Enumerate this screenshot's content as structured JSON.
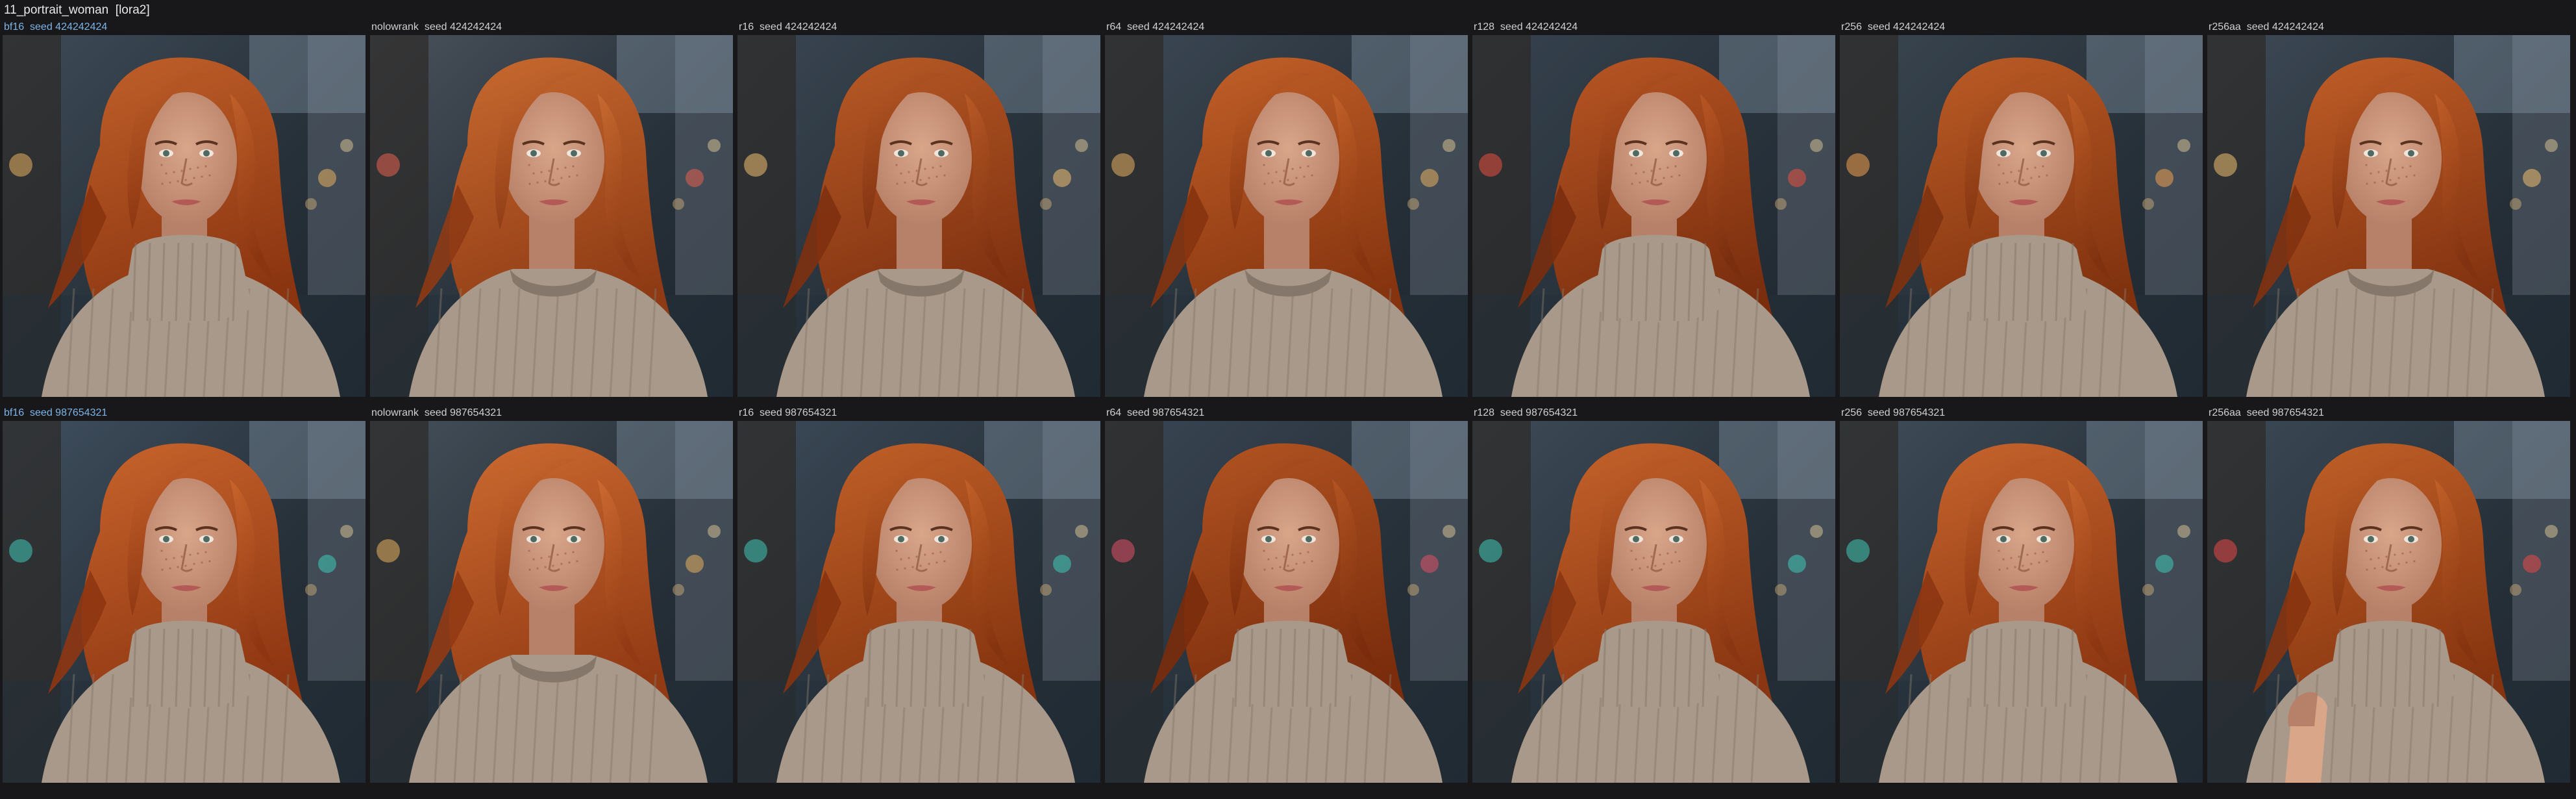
{
  "page": {
    "title": "11_portrait_woman  [lora2]"
  },
  "grid": {
    "rows": [
      {
        "cells": [
          {
            "label": "bf16  seed 424242424",
            "highlight": true,
            "variant": "turtleneck",
            "hair": "#8a3410",
            "hairHi": "#c0602a",
            "bg": "#3e4b57",
            "glow": "#e8b060"
          },
          {
            "label": "nolowrank  seed 424242424",
            "highlight": false,
            "variant": "crewneck",
            "hair": "#8e3a14",
            "hairHi": "#c86a30",
            "bg": "#4a525c",
            "glow": "#e66050"
          },
          {
            "label": "r16  seed 424242424",
            "highlight": false,
            "variant": "crewneck",
            "hair": "#7e3010",
            "hairHi": "#b85a26",
            "bg": "#3a4652",
            "glow": "#f0c070"
          },
          {
            "label": "r64  seed 424242424",
            "highlight": false,
            "variant": "crewneck",
            "hair": "#86340f",
            "hairHi": "#c26028",
            "bg": "#3c4854",
            "glow": "#e8b060"
          },
          {
            "label": "r128  seed 424242424",
            "highlight": false,
            "variant": "turtleneck",
            "hair": "#7a2e0e",
            "hairHi": "#b85624",
            "bg": "#36424e",
            "glow": "#e85040"
          },
          {
            "label": "r256  seed 424242424",
            "highlight": false,
            "variant": "turtleneck",
            "hair": "#80320f",
            "hairHi": "#bc5c26",
            "bg": "#3a4650",
            "glow": "#f0a050"
          },
          {
            "label": "r256aa  seed 424242424",
            "highlight": false,
            "variant": "crewneck",
            "hair": "#823210",
            "hairHi": "#c05e28",
            "bg": "#3e4a56",
            "glow": "#f0c070"
          }
        ]
      },
      {
        "cells": [
          {
            "label": "bf16  seed 987654321",
            "highlight": true,
            "variant": "turtleneck",
            "hair": "#8e3612",
            "hairHi": "#c8642c",
            "bg": "#405060",
            "glow": "#40c8b8"
          },
          {
            "label": "nolowrank  seed 987654321",
            "highlight": false,
            "variant": "crewneck",
            "hair": "#923a14",
            "hairHi": "#cc6a30",
            "bg": "#46505a",
            "glow": "#e8b060"
          },
          {
            "label": "r16  seed 987654321",
            "highlight": false,
            "variant": "turtleneck",
            "hair": "#86340f",
            "hairHi": "#c06028",
            "bg": "#3c4a58",
            "glow": "#40c8b8"
          },
          {
            "label": "r64  seed 987654321",
            "highlight": false,
            "variant": "turtleneck",
            "hair": "#7a2c0c",
            "hairHi": "#b25422",
            "bg": "#3a4654",
            "glow": "#e05068"
          },
          {
            "label": "r128  seed 987654321",
            "highlight": false,
            "variant": "turtleneck",
            "hair": "#8a3612",
            "hairHi": "#c4622a",
            "bg": "#3e4c58",
            "glow": "#40c8b8"
          },
          {
            "label": "r256  seed 987654321",
            "highlight": false,
            "variant": "turtleneck",
            "hair": "#8c3612",
            "hairHi": "#c6642c",
            "bg": "#404e5a",
            "glow": "#40c8b8"
          },
          {
            "label": "r256aa  seed 987654321",
            "highlight": false,
            "variant": "turtleneck-hand",
            "hair": "#86340f",
            "hairHi": "#c06028",
            "bg": "#3c4a56",
            "glow": "#e84848"
          }
        ]
      }
    ]
  }
}
